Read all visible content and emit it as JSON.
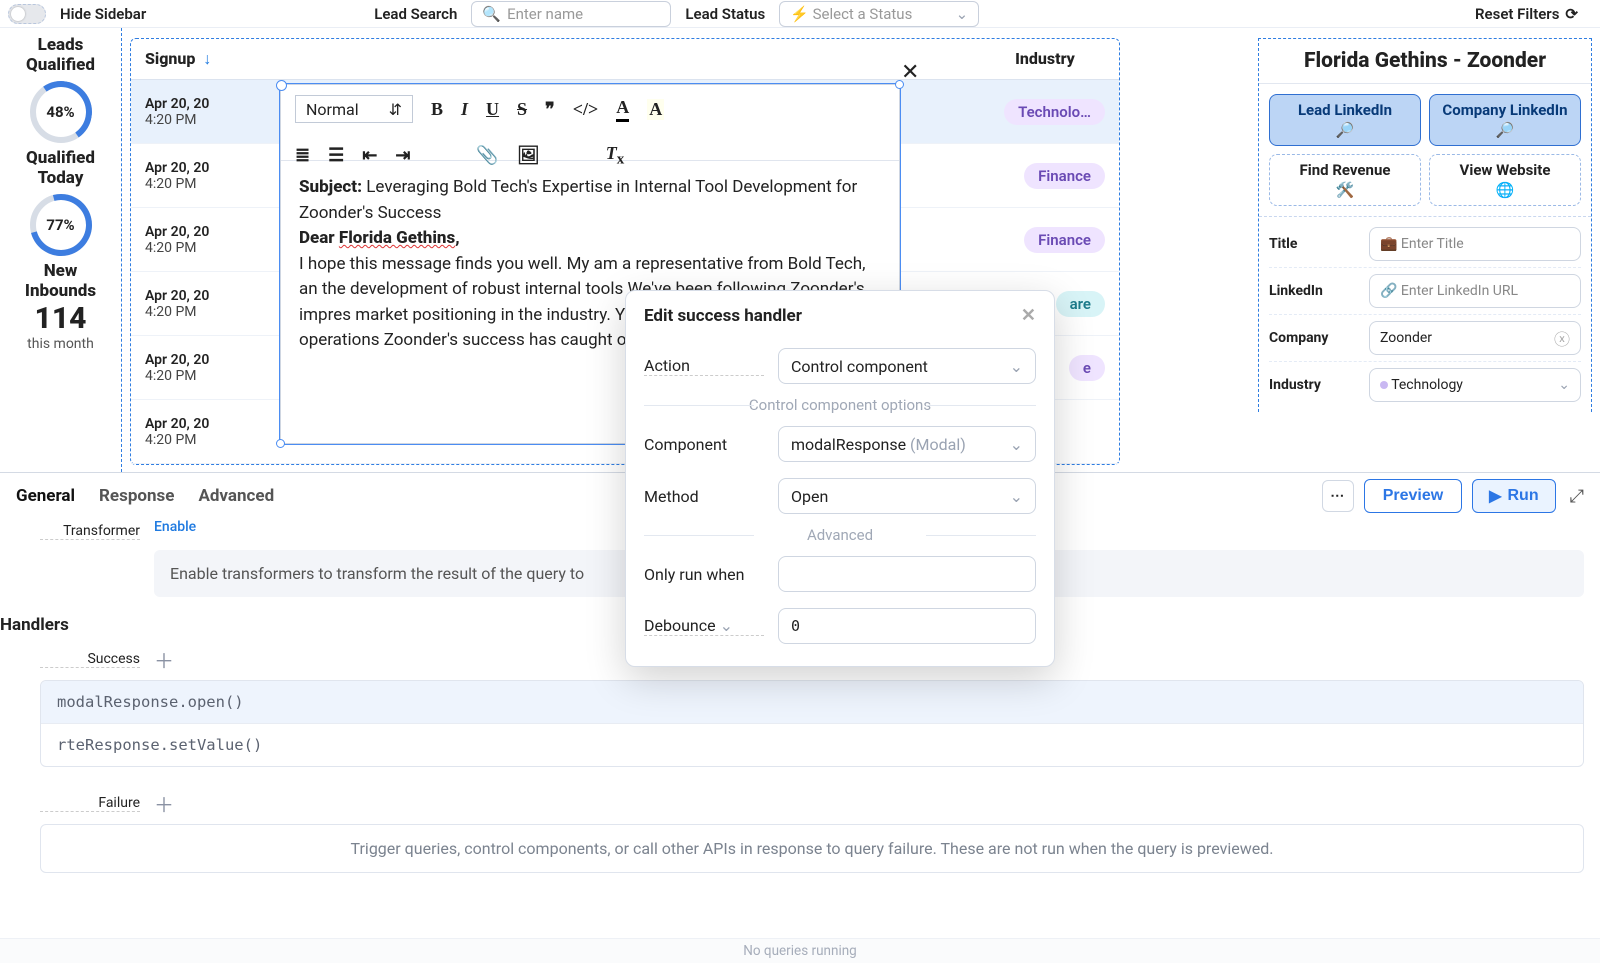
{
  "topbar": {
    "hide_sidebar": "Hide Sidebar",
    "lead_search_label": "Lead Search",
    "lead_search_placeholder": "Enter name",
    "lead_status_label": "Lead Status",
    "lead_status_placeholder": "Select a Status",
    "reset_filters": "Reset Filters"
  },
  "metrics": {
    "leads_qualified": {
      "title1": "Leads",
      "title2": "Qualified",
      "value": "48%"
    },
    "qualified_today": {
      "title1": "Qualified",
      "title2": "Today",
      "value": "77%"
    },
    "new_inbounds": {
      "title1": "New",
      "title2": "Inbounds",
      "value": "114",
      "sub": "this month"
    }
  },
  "table": {
    "signup_header": "Signup",
    "industry_header": "Industry",
    "rows": [
      {
        "d": "Apr 20, 20",
        "t": "4:20 PM",
        "industry": "Technolo…",
        "k": "tech"
      },
      {
        "d": "Apr 20, 20",
        "t": "4:20 PM",
        "industry": "Finance",
        "k": "fin"
      },
      {
        "d": "Apr 20, 20",
        "t": "4:20 PM",
        "industry": "Finance",
        "k": "fin"
      },
      {
        "d": "Apr 20, 20",
        "t": "4:20 PM",
        "industry": "are",
        "k": "hc"
      },
      {
        "d": "Apr 20, 20",
        "t": "4:20 PM",
        "industry": "e",
        "k": "fin"
      },
      {
        "d": "Apr 20, 20",
        "t": "4:20 PM",
        "industry": "",
        "k": ""
      }
    ]
  },
  "rte": {
    "format_style": "Normal",
    "subject_label": "Subject:",
    "subject_text": "Leveraging Bold Tech's Expertise in Internal Tool Development for Zoonder's Success",
    "salutation_prefix": "Dear ",
    "salutation_name": "Florida Gethins",
    "salutation_suffix": ",",
    "body": " I hope this message finds you well. My am a representative from Bold Tech, an the development of robust internal tools  We've been following Zoonder's impres market positioning in the industry. Your i breakthrough in the business operations Zoonder's success has caught our atten"
  },
  "detail": {
    "title": "Florida Gethins - Zoonder",
    "buttons": {
      "lead_li": "Lead LinkedIn",
      "company_li": "Company LinkedIn",
      "find_revenue": "Find Revenue",
      "view_website": "View Website"
    },
    "fields": {
      "title_label": "Title",
      "title_placeholder": "Enter Title",
      "linkedin_label": "LinkedIn",
      "linkedin_placeholder": "Enter LinkedIn URL",
      "company_label": "Company",
      "company_value": "Zoonder",
      "industry_label": "Industry",
      "industry_value": "Technology"
    }
  },
  "popover": {
    "title": "Edit success handler",
    "action_label": "Action",
    "action_value": "Control component",
    "options_section": "Control component options",
    "component_label": "Component",
    "component_value": "modalResponse",
    "component_type": "(Modal)",
    "method_label": "Method",
    "method_value": "Open",
    "advanced_section": "Advanced",
    "only_run_label": "Only run when",
    "debounce_label": "Debounce",
    "debounce_value": "0"
  },
  "bottom": {
    "tabs": {
      "general": "General",
      "response": "Response",
      "advanced": "Advanced"
    },
    "preview": "Preview",
    "run": "Run",
    "transformer_label": "Transformer",
    "transformer_enable": "Enable",
    "transformer_hint": "Enable transformers to transform the result of the query to",
    "handlers_header": "Handlers",
    "success_label": "Success",
    "handlers": [
      "modalResponse.open()",
      "rteResponse.setValue()"
    ],
    "failure_label": "Failure",
    "failure_hint": "Trigger queries, control components, or call other APIs in response to query failure. These are not run when the query is previewed.",
    "status": "No queries running"
  }
}
